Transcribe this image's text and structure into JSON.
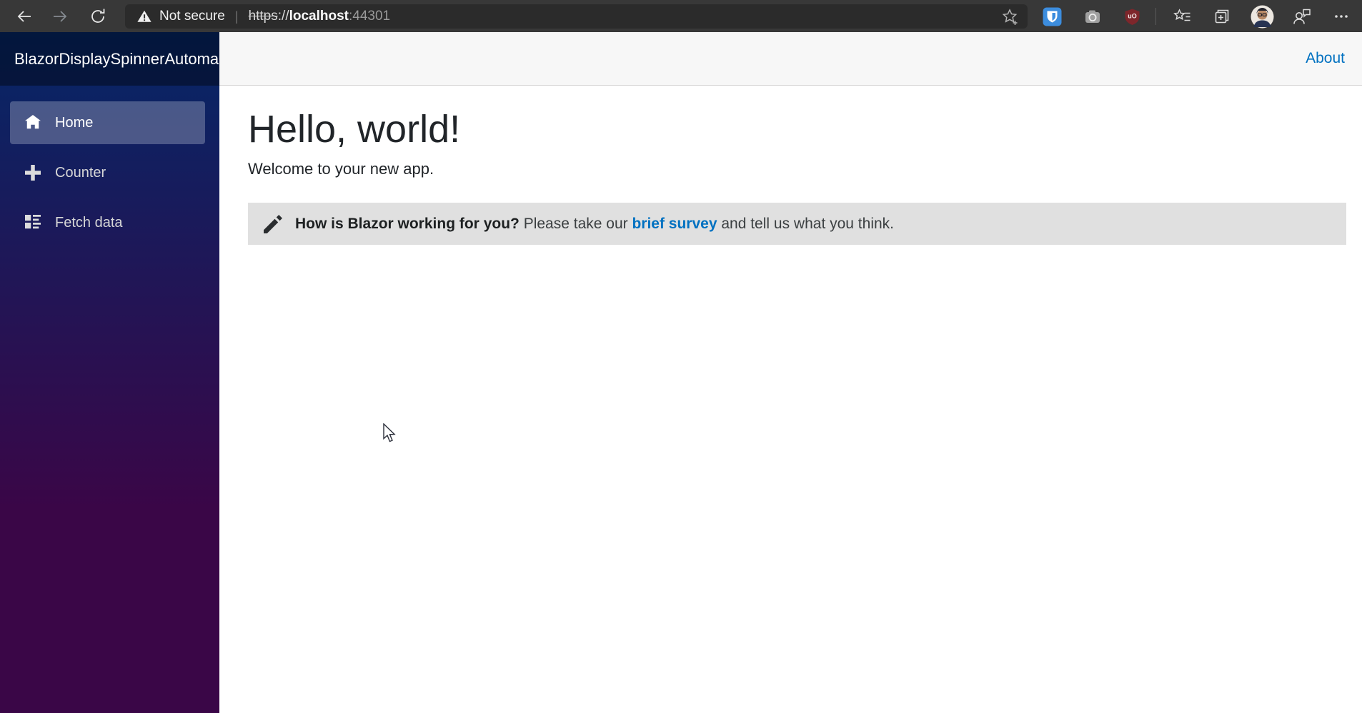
{
  "browser": {
    "security_label": "Not secure",
    "divider": "|",
    "url": {
      "scheme": "https",
      "separator": "://",
      "host": "localhost",
      "port": ":44301"
    },
    "toolbar_icons": [
      "back-arrow",
      "forward-arrow",
      "refresh",
      "site-warning",
      "add-favorite-star",
      "bitwarden-extension",
      "camera-extension",
      "ublock-extension",
      "favorites-bar",
      "collections",
      "profile-avatar",
      "feedback",
      "more-menu"
    ]
  },
  "app": {
    "brand": "BlazorDisplaySpinnerAutoma",
    "about_label": "About"
  },
  "sidebar": {
    "items": [
      {
        "label": "Home",
        "icon": "home-icon",
        "active": true
      },
      {
        "label": "Counter",
        "icon": "plus-icon",
        "active": false
      },
      {
        "label": "Fetch data",
        "icon": "list-rich-icon",
        "active": false
      }
    ]
  },
  "main": {
    "heading": "Hello, world!",
    "subtitle": "Welcome to your new app.",
    "survey": {
      "bold_lead": "How is Blazor working for you?",
      "text_before_link": " Please take our ",
      "link_label": "brief survey",
      "text_after_link": " and tell us what you think."
    }
  },
  "colors": {
    "chrome-bg": "#383838",
    "urlbar-bg": "#2b2b2b",
    "sidebar-top": "#052767",
    "sidebar-bottom": "#3a0647",
    "active-item-bg": "rgba(255,255,255,0.25)",
    "topbar-bg": "#f7f7f7",
    "topbar-border": "#d6d5d5",
    "link-blue": "#0071c1",
    "survey-bg": "#e0e0e0",
    "heading-color": "#212529",
    "bitwarden-blue": "#3c8dde",
    "ublock-red": "#7e262b"
  }
}
